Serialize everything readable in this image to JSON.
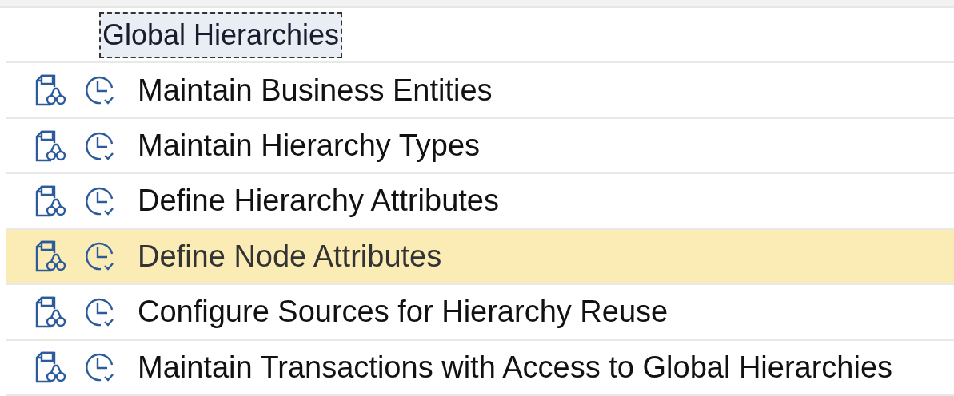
{
  "header": {
    "label": "Global Hierarchies",
    "focused": true
  },
  "rows": [
    {
      "label": "Maintain Business Entities",
      "selected": false
    },
    {
      "label": "Maintain Hierarchy Types",
      "selected": false
    },
    {
      "label": "Define Hierarchy Attributes",
      "selected": false
    },
    {
      "label": "Define Node Attributes",
      "selected": true
    },
    {
      "label": "Configure Sources for Hierarchy Reuse",
      "selected": false
    },
    {
      "label": "Maintain Transactions with Access to Global Hierarchies",
      "selected": false
    }
  ]
}
